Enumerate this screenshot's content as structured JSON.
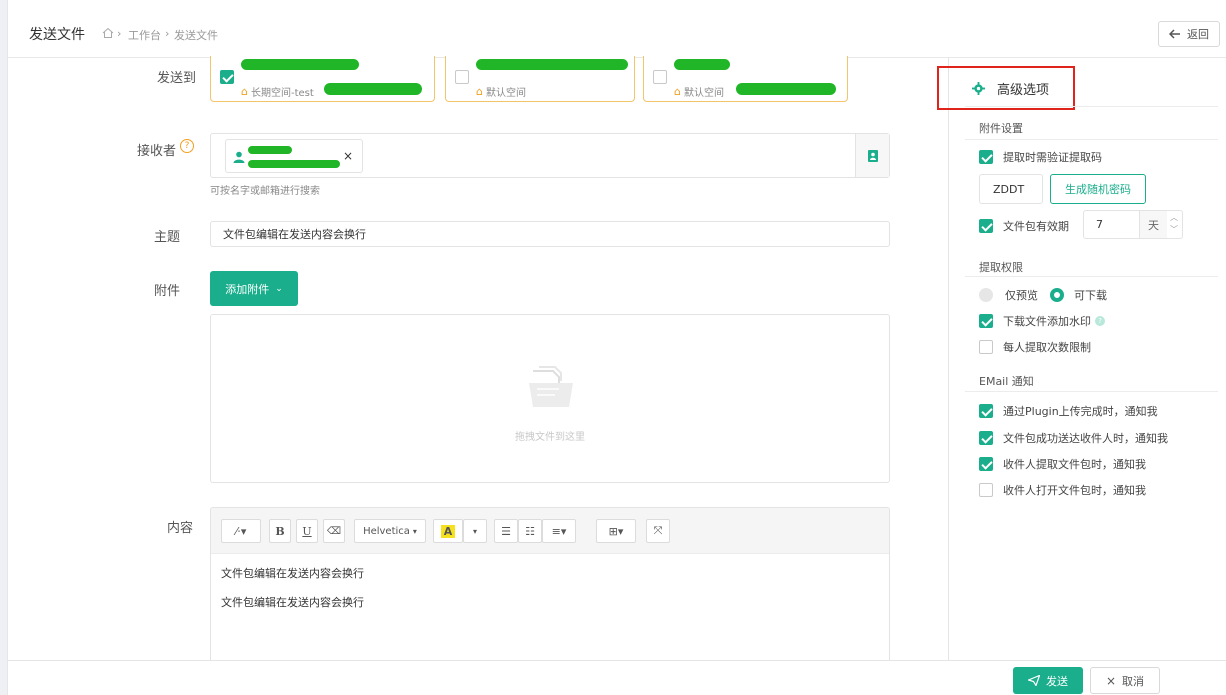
{
  "header": {
    "title": "发送文件",
    "breadcrumb": [
      "工作台",
      "发送文件"
    ],
    "back_label": "返回"
  },
  "form": {
    "send_to_label": "发送到",
    "send_to_cards": [
      {
        "checked": true,
        "space": "长期空间-test"
      },
      {
        "checked": false,
        "space": "默认空间"
      },
      {
        "checked": false,
        "space": "默认空间"
      }
    ],
    "recipient_label": "接收者",
    "recipient_hint": "可按名字或邮箱进行搜索",
    "subject_label": "主题",
    "subject_value": "文件包编辑在发送内容会换行",
    "attachment_label": "附件",
    "add_attachment_label": "添加附件",
    "drop_text": "拖拽文件到这里",
    "content_label": "内容",
    "editor": {
      "font_name": "Helvetica",
      "lines": [
        "文件包编辑在发送内容会换行",
        "文件包编辑在发送内容会换行"
      ]
    }
  },
  "advanced": {
    "title": "高级选项",
    "attachment_settings": {
      "title": "附件设置",
      "require_code_label": "提取时需验证提取码",
      "require_code_checked": true,
      "code_value": "ZDDT",
      "generate_label": "生成随机密码",
      "validity_label": "文件包有效期",
      "validity_checked": true,
      "validity_value": "7",
      "validity_unit": "天"
    },
    "permissions": {
      "title": "提取权限",
      "preview_only": "仅预览",
      "downloadable": "可下载",
      "watermark_label": "下载文件添加水印",
      "watermark_checked": true,
      "limit_label": "每人提取次数限制",
      "limit_checked": false
    },
    "email": {
      "title": "EMail 通知",
      "items": [
        {
          "label": "通过Plugin上传完成时，通知我",
          "checked": true
        },
        {
          "label": "文件包成功送达收件人时，通知我",
          "checked": true
        },
        {
          "label": "收件人提取文件包时，通知我",
          "checked": true
        },
        {
          "label": "收件人打开文件包时，通知我",
          "checked": false
        }
      ]
    }
  },
  "footer": {
    "send_label": "发送",
    "cancel_label": "取消"
  },
  "colors": {
    "accent": "#1aae8c",
    "highlight": "#e0241c",
    "card_border": "#f3c56b",
    "redaction": "#21b627"
  }
}
